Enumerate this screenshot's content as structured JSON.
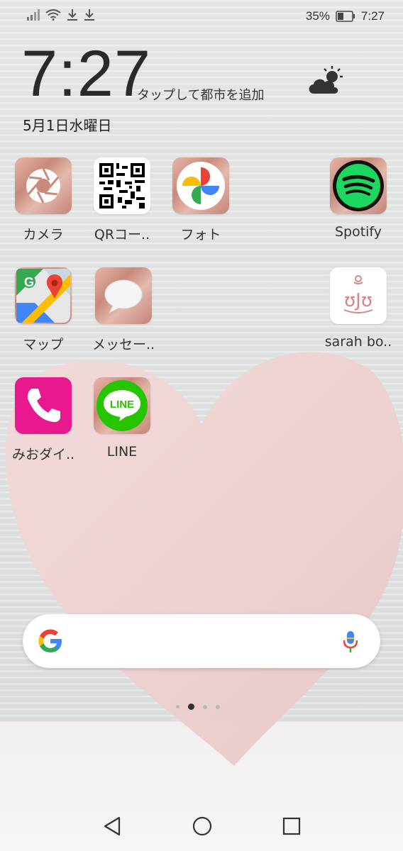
{
  "status_bar": {
    "battery_percent": "35%",
    "time": "7:27",
    "icons": [
      "signal-icon",
      "wifi-icon",
      "download-icon",
      "download-icon",
      "battery-icon"
    ]
  },
  "clock_widget": {
    "time": "7:27",
    "add_city": "タップして都市を追加",
    "date": "5月1日水曜日",
    "weather_icon": "partly-cloudy-icon"
  },
  "apps": [
    {
      "label": "カメラ",
      "icon": "camera-icon"
    },
    {
      "label": "QRコー..",
      "icon": "qr-code-icon"
    },
    {
      "label": "フォト",
      "icon": "photos-icon"
    },
    {
      "label": "Spotify",
      "icon": "spotify-icon"
    },
    {
      "label": "マップ",
      "icon": "maps-icon"
    },
    {
      "label": "メッセー..",
      "icon": "messages-icon"
    },
    {
      "label": "sarah bo..",
      "icon": "sarah-icon"
    },
    {
      "label": "みおダイ..",
      "icon": "phone-icon"
    },
    {
      "label": "LINE",
      "icon": "line-icon"
    }
  ],
  "line_icon_text": "LINE",
  "sarah_icon_text": "ʊJʊ",
  "search": {
    "placeholder": "",
    "logo": "G"
  },
  "page_indicator": {
    "pages": 3,
    "current": 1
  },
  "navigation": [
    "back-icon",
    "home-icon",
    "recents-icon"
  ],
  "colors": {
    "line_green": "#27c400",
    "spotify_green": "#1ed760",
    "phone_pink": "#e8188e"
  }
}
